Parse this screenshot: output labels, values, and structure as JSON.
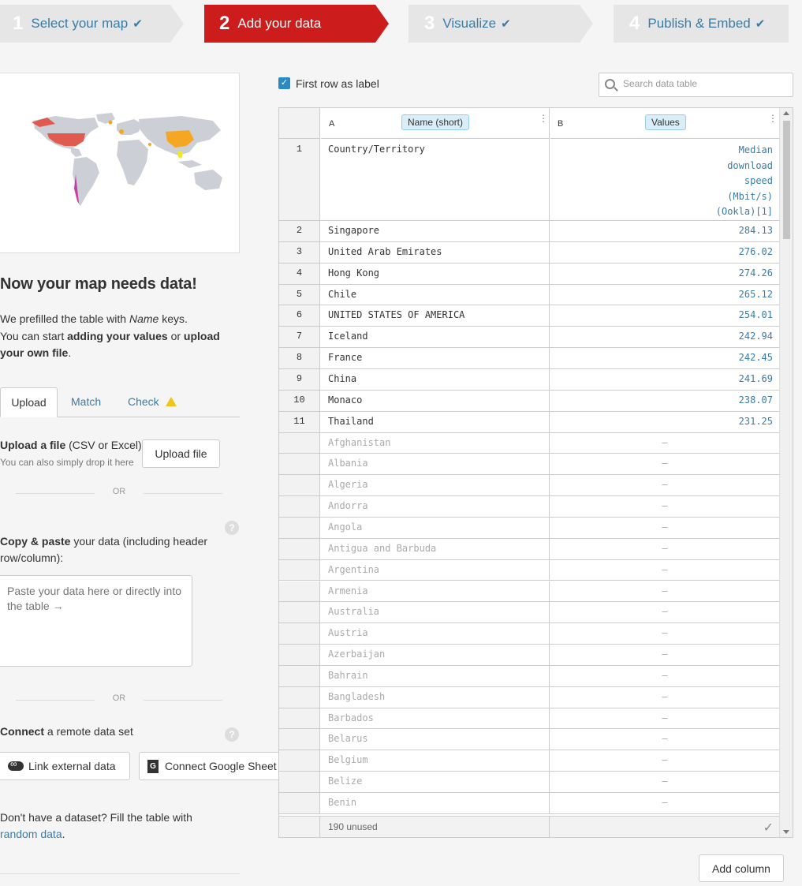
{
  "steps": [
    {
      "num": "1",
      "label": "Select your map",
      "check": "✔"
    },
    {
      "num": "2",
      "label": "Add your data",
      "check": ""
    },
    {
      "num": "3",
      "label": "Visualize",
      "check": "✔"
    },
    {
      "num": "4",
      "label": "Publish & Embed",
      "check": "✔"
    }
  ],
  "colors": {
    "accent": "#cc1c1c",
    "link": "#3a7ca5",
    "badge": "#d9eef8"
  },
  "left": {
    "title": "Now your map needs data!",
    "intro_1": "We prefilled the table with ",
    "intro_name": "Name",
    "intro_2": " keys.",
    "intro_3": "You can start ",
    "intro_bold1": "adding your values",
    "intro_4": " or ",
    "intro_bold2": "upload your own file",
    "intro_5": ".",
    "tabs": {
      "upload": "Upload",
      "match": "Match",
      "check": "Check"
    },
    "upload_bold": "Upload a file",
    "upload_rest": " (CSV or Excel)",
    "upload_sub": "You can also simply drop it here",
    "upload_button": "Upload file",
    "or": "OR",
    "help": "?",
    "paste_bold": "Copy & paste",
    "paste_rest": " your data (including header row/column):",
    "paste_placeholder": "Paste your data here or directly into the table →",
    "connect_bold": "Connect",
    "connect_rest": " a remote data set",
    "link_button": "Link external data",
    "gsheet_button": "Connect Google Sheet",
    "gsheet_icon_letter": "G",
    "random_1": "Don't have a dataset? Fill the table with",
    "random_link": "random data",
    "random_2": "."
  },
  "right": {
    "first_row_label": "First row as label",
    "search_placeholder": "Search data table",
    "col_a_letter": "A",
    "col_a_badge": "Name (short)",
    "col_b_letter": "B",
    "col_b_badge": "Values",
    "header_row": {
      "num": "1",
      "a": "Country/Territory",
      "b": [
        "Median",
        "download",
        "speed",
        "(Mbit/s)",
        "(Ookla)[1]"
      ]
    },
    "rows": [
      {
        "num": "2",
        "a": "Singapore",
        "b": "284.13"
      },
      {
        "num": "3",
        "a": "United Arab Emirates",
        "b": "276.02"
      },
      {
        "num": "4",
        "a": "Hong Kong",
        "b": "274.26"
      },
      {
        "num": "5",
        "a": "Chile",
        "b": "265.12"
      },
      {
        "num": "6",
        "a": "UNITED STATES OF AMERICA",
        "b": "254.01"
      },
      {
        "num": "7",
        "a": "Iceland",
        "b": "242.94"
      },
      {
        "num": "8",
        "a": "France",
        "b": "242.45"
      },
      {
        "num": "9",
        "a": "China",
        "b": "241.69"
      },
      {
        "num": "10",
        "a": "Monaco",
        "b": "238.07"
      },
      {
        "num": "11",
        "a": "Thailand",
        "b": "231.25"
      }
    ],
    "unused_rows": [
      "Afghanistan",
      "Albania",
      "Algeria",
      "Andorra",
      "Angola",
      "Antigua and Barbuda",
      "Argentina",
      "Armenia",
      "Australia",
      "Austria",
      "Azerbaijan",
      "Bahrain",
      "Bangladesh",
      "Barbados",
      "Belarus",
      "Belgium",
      "Belize",
      "Benin"
    ],
    "unused_dash": "–",
    "footer": "190 unused",
    "add_column": "Add column"
  }
}
